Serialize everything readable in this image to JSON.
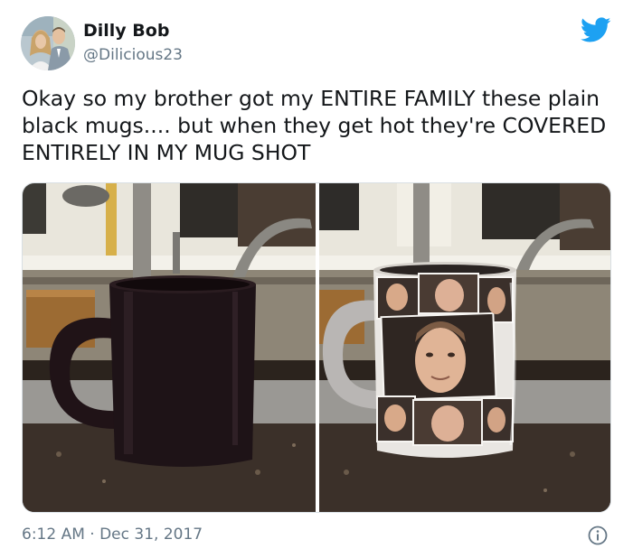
{
  "author": {
    "name": "Dilly Bob",
    "handle": "@Dilicious23"
  },
  "tweet": {
    "text": "Okay so my brother got my ENTIRE FAMILY these plain black mugs.... but when they get hot they're COVERED ENTIRELY IN MY MUG SHOT",
    "timestamp": "6:12 AM · Dec 31, 2017"
  },
  "icons": {
    "platform": "twitter-bird-icon",
    "info": "info-icon"
  },
  "colors": {
    "brand": "#1da1f2",
    "secondary_text": "#657786",
    "primary_text": "#14171a"
  },
  "media": [
    {
      "description_name": "black-mug-cold-photo"
    },
    {
      "description_name": "mug-hot-faces-photo"
    }
  ]
}
